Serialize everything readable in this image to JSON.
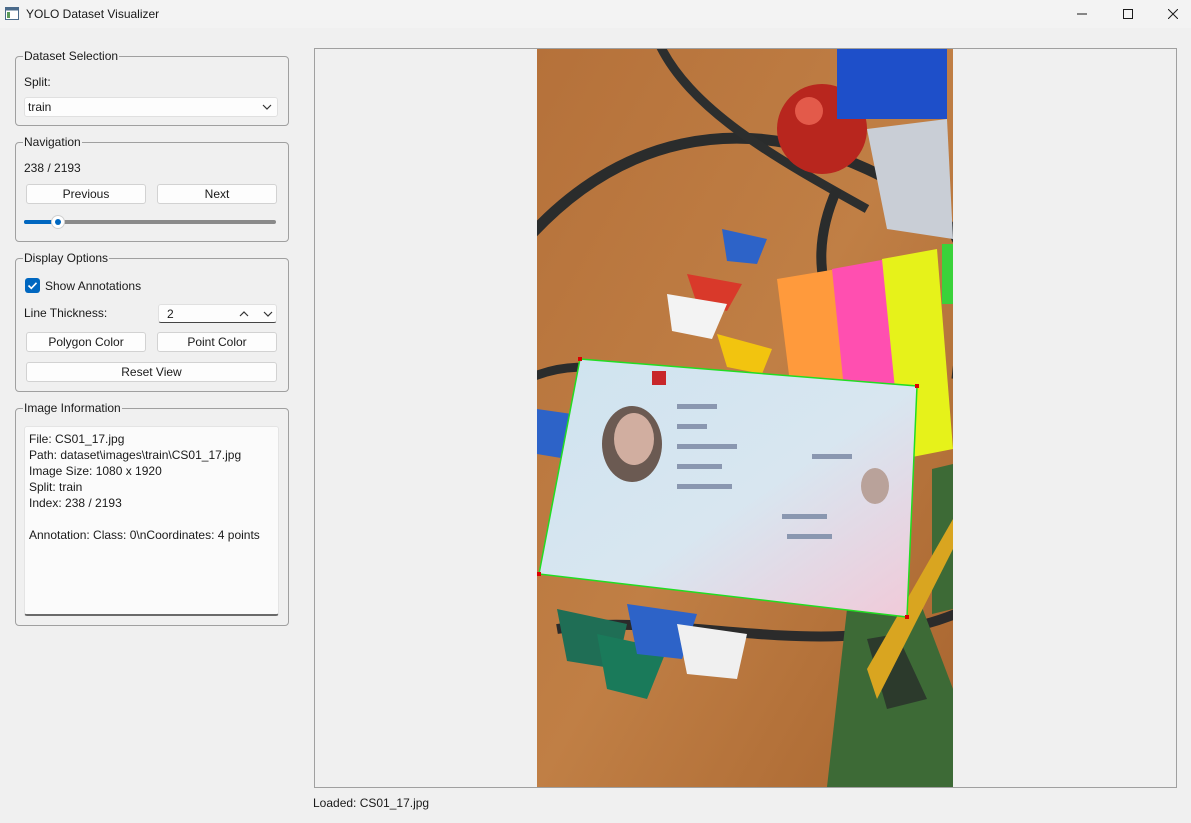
{
  "window": {
    "title": "YOLO Dataset Visualizer",
    "icon": "app-window-icon",
    "controls": [
      "minimize-icon",
      "maximize-icon",
      "close-icon"
    ]
  },
  "dataset_selection": {
    "title": "Dataset Selection",
    "split_label": "Split:",
    "split_value": "train"
  },
  "navigation": {
    "title": "Navigation",
    "position": "238 / 2193",
    "previous_label": "Previous",
    "next_label": "Next",
    "slider_fraction": 0.1085
  },
  "display_options": {
    "title": "Display Options",
    "show_annotations_label": "Show Annotations",
    "show_annotations_checked": true,
    "line_thickness_label": "Line Thickness:",
    "line_thickness_value": "2",
    "polygon_color_label": "Polygon Color",
    "point_color_label": "Point Color",
    "reset_view_label": "Reset View"
  },
  "image_information": {
    "title": "Image Information",
    "lines": [
      "File: CS01_17.jpg",
      "Path: dataset\\images\\train\\CS01_17.jpg",
      "Image Size: 1080 x 1920",
      "Split: train",
      "Index: 238 / 2193",
      "",
      "Annotation: Class: 0\\nCoordinates: 4 points"
    ]
  },
  "annotation": {
    "polygon_color": "#22dd22",
    "point_color": "#dd0000",
    "points": 4
  },
  "colors": {
    "accent": "#0067c0",
    "window_bg": "#f0f0f0"
  },
  "status_bar": {
    "text": "Loaded: CS01_17.jpg"
  }
}
